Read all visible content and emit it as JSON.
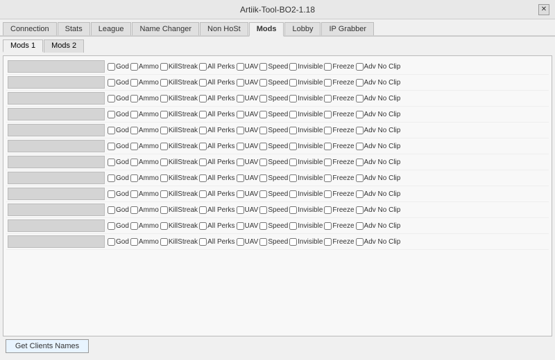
{
  "window": {
    "title": "Artiik-Tool-BO2-1.18",
    "close_icon": "✕"
  },
  "nav_tabs": [
    {
      "label": "Connection",
      "active": false
    },
    {
      "label": "Stats",
      "active": false
    },
    {
      "label": "League",
      "active": false
    },
    {
      "label": "Name Changer",
      "active": false
    },
    {
      "label": "Non HoSt",
      "active": false
    },
    {
      "label": "Mods",
      "active": true
    },
    {
      "label": "Lobby",
      "active": false
    },
    {
      "label": "IP Grabber",
      "active": false
    }
  ],
  "sub_tabs": [
    {
      "label": "Mods 1",
      "active": true
    },
    {
      "label": "Mods 2",
      "active": false
    }
  ],
  "checkboxes": [
    "God",
    "Ammo",
    "KillStreak",
    "All Perks",
    "UAV",
    "Speed",
    "Invisible",
    "Freeze",
    "Adv No Clip"
  ],
  "num_rows": 12,
  "bottom_button": "Get Clients Names"
}
